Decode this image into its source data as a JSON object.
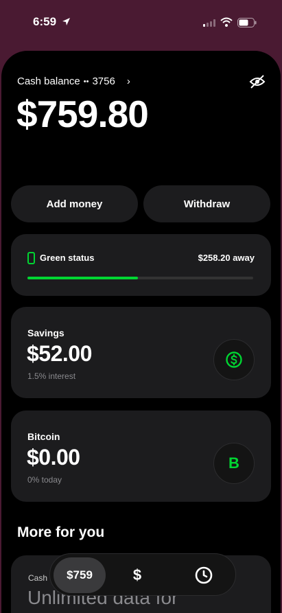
{
  "status_bar": {
    "time": "6:59"
  },
  "balance": {
    "label": "Cash balance",
    "account_dots": "••",
    "account_last4": "3756",
    "amount": "$759.80"
  },
  "actions": {
    "add_money": "Add money",
    "withdraw": "Withdraw"
  },
  "green_status": {
    "label": "Green status",
    "away": "$258.20 away",
    "progress_fraction": 0.49,
    "color": "#00d632"
  },
  "savings": {
    "title": "Savings",
    "amount": "$52.00",
    "sub": "1.5% interest",
    "icon": "dollar-circle-icon"
  },
  "bitcoin": {
    "title": "Bitcoin",
    "amount": "$0.00",
    "sub": "0% today",
    "icon_glyph": "B"
  },
  "more": {
    "title": "More for you",
    "promo_label": "Cash",
    "promo_text": "Unlimited data for"
  },
  "tabbar": {
    "balance_label": "$759",
    "pay_glyph": "$"
  },
  "colors": {
    "accent": "#00d632",
    "background_top": "#4a1a32",
    "card": "#1c1c1e"
  }
}
